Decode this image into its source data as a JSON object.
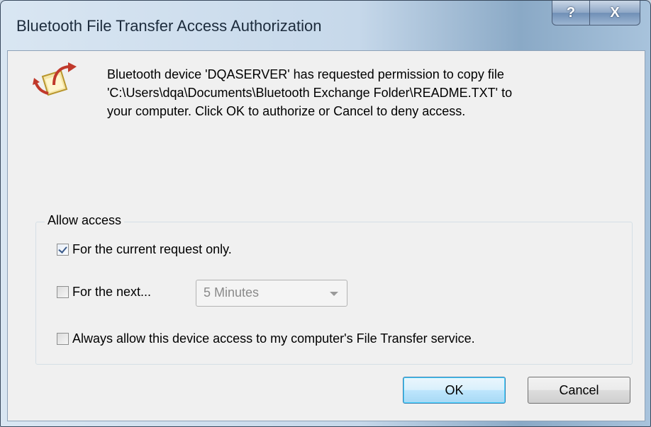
{
  "window": {
    "title": "Bluetooth File Transfer Access Authorization",
    "help_label": "?",
    "close_label": "X"
  },
  "message": {
    "icon": "file-transfer-arrow-icon",
    "text": "Bluetooth device 'DQASERVER' has requested permission to copy file\n'C:\\Users\\dqa\\Documents\\Bluetooth Exchange Folder\\README.TXT' to\nyour computer.  Click OK to authorize or Cancel to deny access."
  },
  "access": {
    "group_label": "Allow access",
    "options": [
      {
        "label": "For the current request only.",
        "checked": true
      },
      {
        "label": "For the next...",
        "checked": false
      },
      {
        "label": "Always allow this device access to my computer's File Transfer service.",
        "checked": false
      }
    ],
    "duration": {
      "selected": "5 Minutes",
      "enabled": false
    }
  },
  "buttons": {
    "ok": "OK",
    "cancel": "Cancel"
  }
}
